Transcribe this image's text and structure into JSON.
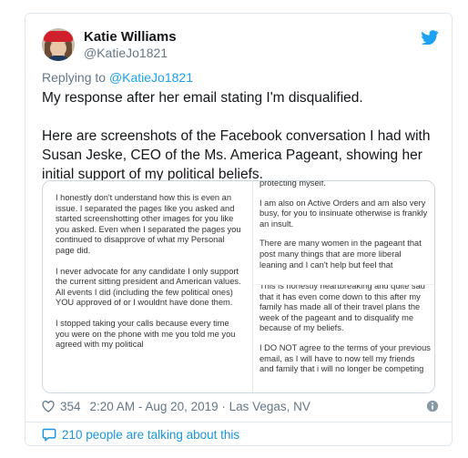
{
  "author": {
    "name": "Katie Williams",
    "handle": "@KatieJo1821",
    "avatar_icon": "profile-photo"
  },
  "brand_color": "#1da1f2",
  "replying": {
    "prefix": "Replying to ",
    "target": "@KatieJo1821"
  },
  "tweet": {
    "line1": "My response after her email stating I'm disqualified.",
    "line2": "Here are screenshots of the Facebook conversation I had with Susan Jeske, CEO of the Ms. America Pageant, showing her initial support of my political beliefs."
  },
  "images": {
    "left": [
      "I honestly don't understand how this is even an issue. I separated the pages like you asked and started screenshotting other images for you like you asked. Even when I separated the pages you continued to disapprove of what my Personal page did.",
      "I never advocate for any candidate I only support the current sitting president and American values. All events I did (including the few political ones) YOU approved of or I wouldnt have done them.",
      "I stopped taking your calls because every time you were on the phone with me you told me you agreed with my political"
    ],
    "right_top": [
      "protecting myself.",
      "I am also on Active Orders and am also very busy, for you to insinuate otherwise is frankly an insult.",
      "There are many women in the pageant that post many things that are more liberal leaning and I can't help but feel that"
    ],
    "right_bottom": [
      "This is honestly heartbreaking and quite sad that it has even come down to this after my family has made all of their travel plans the week of the pageant and to disqualify me because of my beliefs.",
      "I DO NOT agree to the terms of your previous email, as I will have to now tell my friends and family that i will no longer be competing"
    ]
  },
  "meta": {
    "likes": "354",
    "timestamp": "2:20 AM - Aug 20, 2019 · Las Vegas, NV"
  },
  "footer": {
    "talking": "210 people are talking about this"
  }
}
